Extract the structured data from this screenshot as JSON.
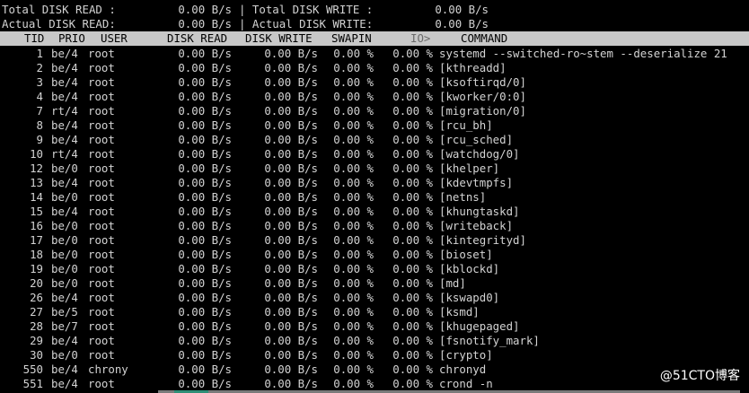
{
  "summary": {
    "total_read_label": "Total DISK READ :",
    "total_read_value": "0.00 B/s",
    "total_write_label": "| Total DISK WRITE :",
    "total_write_value": "0.00 B/s",
    "actual_read_label": "Actual DISK READ:",
    "actual_read_value": "0.00 B/s",
    "actual_write_label": "| Actual DISK WRITE:",
    "actual_write_value": "0.00 B/s"
  },
  "columns": {
    "tid": "TID",
    "prio": "PRIO",
    "user": "USER",
    "disk_read": "DISK READ",
    "disk_write": "DISK WRITE",
    "swapin": "SWAPIN",
    "io": "IO>",
    "command": "COMMAND"
  },
  "rows": [
    {
      "tid": "1",
      "prio": "be/4",
      "user": "root",
      "read": "0.00 B/s",
      "write": "0.00 B/s",
      "swapin": "0.00 %",
      "io": "0.00 %",
      "command": "systemd --switched-ro~stem --deserialize 21"
    },
    {
      "tid": "2",
      "prio": "be/4",
      "user": "root",
      "read": "0.00 B/s",
      "write": "0.00 B/s",
      "swapin": "0.00 %",
      "io": "0.00 %",
      "command": "[kthreadd]"
    },
    {
      "tid": "3",
      "prio": "be/4",
      "user": "root",
      "read": "0.00 B/s",
      "write": "0.00 B/s",
      "swapin": "0.00 %",
      "io": "0.00 %",
      "command": "[ksoftirqd/0]"
    },
    {
      "tid": "4",
      "prio": "be/4",
      "user": "root",
      "read": "0.00 B/s",
      "write": "0.00 B/s",
      "swapin": "0.00 %",
      "io": "0.00 %",
      "command": "[kworker/0:0]"
    },
    {
      "tid": "7",
      "prio": "rt/4",
      "user": "root",
      "read": "0.00 B/s",
      "write": "0.00 B/s",
      "swapin": "0.00 %",
      "io": "0.00 %",
      "command": "[migration/0]"
    },
    {
      "tid": "8",
      "prio": "be/4",
      "user": "root",
      "read": "0.00 B/s",
      "write": "0.00 B/s",
      "swapin": "0.00 %",
      "io": "0.00 %",
      "command": "[rcu_bh]"
    },
    {
      "tid": "9",
      "prio": "be/4",
      "user": "root",
      "read": "0.00 B/s",
      "write": "0.00 B/s",
      "swapin": "0.00 %",
      "io": "0.00 %",
      "command": "[rcu_sched]"
    },
    {
      "tid": "10",
      "prio": "rt/4",
      "user": "root",
      "read": "0.00 B/s",
      "write": "0.00 B/s",
      "swapin": "0.00 %",
      "io": "0.00 %",
      "command": "[watchdog/0]"
    },
    {
      "tid": "12",
      "prio": "be/0",
      "user": "root",
      "read": "0.00 B/s",
      "write": "0.00 B/s",
      "swapin": "0.00 %",
      "io": "0.00 %",
      "command": "[khelper]"
    },
    {
      "tid": "13",
      "prio": "be/4",
      "user": "root",
      "read": "0.00 B/s",
      "write": "0.00 B/s",
      "swapin": "0.00 %",
      "io": "0.00 %",
      "command": "[kdevtmpfs]"
    },
    {
      "tid": "14",
      "prio": "be/0",
      "user": "root",
      "read": "0.00 B/s",
      "write": "0.00 B/s",
      "swapin": "0.00 %",
      "io": "0.00 %",
      "command": "[netns]"
    },
    {
      "tid": "15",
      "prio": "be/4",
      "user": "root",
      "read": "0.00 B/s",
      "write": "0.00 B/s",
      "swapin": "0.00 %",
      "io": "0.00 %",
      "command": "[khungtaskd]"
    },
    {
      "tid": "16",
      "prio": "be/0",
      "user": "root",
      "read": "0.00 B/s",
      "write": "0.00 B/s",
      "swapin": "0.00 %",
      "io": "0.00 %",
      "command": "[writeback]"
    },
    {
      "tid": "17",
      "prio": "be/0",
      "user": "root",
      "read": "0.00 B/s",
      "write": "0.00 B/s",
      "swapin": "0.00 %",
      "io": "0.00 %",
      "command": "[kintegrityd]"
    },
    {
      "tid": "18",
      "prio": "be/0",
      "user": "root",
      "read": "0.00 B/s",
      "write": "0.00 B/s",
      "swapin": "0.00 %",
      "io": "0.00 %",
      "command": "[bioset]"
    },
    {
      "tid": "19",
      "prio": "be/0",
      "user": "root",
      "read": "0.00 B/s",
      "write": "0.00 B/s",
      "swapin": "0.00 %",
      "io": "0.00 %",
      "command": "[kblockd]"
    },
    {
      "tid": "20",
      "prio": "be/0",
      "user": "root",
      "read": "0.00 B/s",
      "write": "0.00 B/s",
      "swapin": "0.00 %",
      "io": "0.00 %",
      "command": "[md]"
    },
    {
      "tid": "26",
      "prio": "be/4",
      "user": "root",
      "read": "0.00 B/s",
      "write": "0.00 B/s",
      "swapin": "0.00 %",
      "io": "0.00 %",
      "command": "[kswapd0]"
    },
    {
      "tid": "27",
      "prio": "be/5",
      "user": "root",
      "read": "0.00 B/s",
      "write": "0.00 B/s",
      "swapin": "0.00 %",
      "io": "0.00 %",
      "command": "[ksmd]"
    },
    {
      "tid": "28",
      "prio": "be/7",
      "user": "root",
      "read": "0.00 B/s",
      "write": "0.00 B/s",
      "swapin": "0.00 %",
      "io": "0.00 %",
      "command": "[khugepaged]"
    },
    {
      "tid": "29",
      "prio": "be/4",
      "user": "root",
      "read": "0.00 B/s",
      "write": "0.00 B/s",
      "swapin": "0.00 %",
      "io": "0.00 %",
      "command": "[fsnotify_mark]"
    },
    {
      "tid": "30",
      "prio": "be/0",
      "user": "root",
      "read": "0.00 B/s",
      "write": "0.00 B/s",
      "swapin": "0.00 %",
      "io": "0.00 %",
      "command": "[crypto]"
    },
    {
      "tid": "550",
      "prio": "be/4",
      "user": "chrony",
      "read": "0.00 B/s",
      "write": "0.00 B/s",
      "swapin": "0.00 %",
      "io": "0.00 %",
      "command": "chronyd"
    },
    {
      "tid": "551",
      "prio": "be/4",
      "user": "root",
      "read": "0.00 B/s",
      "write": "0.00 B/s",
      "swapin": "0.00 %",
      "io": "0.00 %",
      "command": "crond -n"
    }
  ],
  "watermark": "@51CTO博客",
  "colors": {
    "background": "#000000",
    "text": "#d3d3d3",
    "header_bar": "#c8c8c8",
    "header_text": "#000000"
  }
}
